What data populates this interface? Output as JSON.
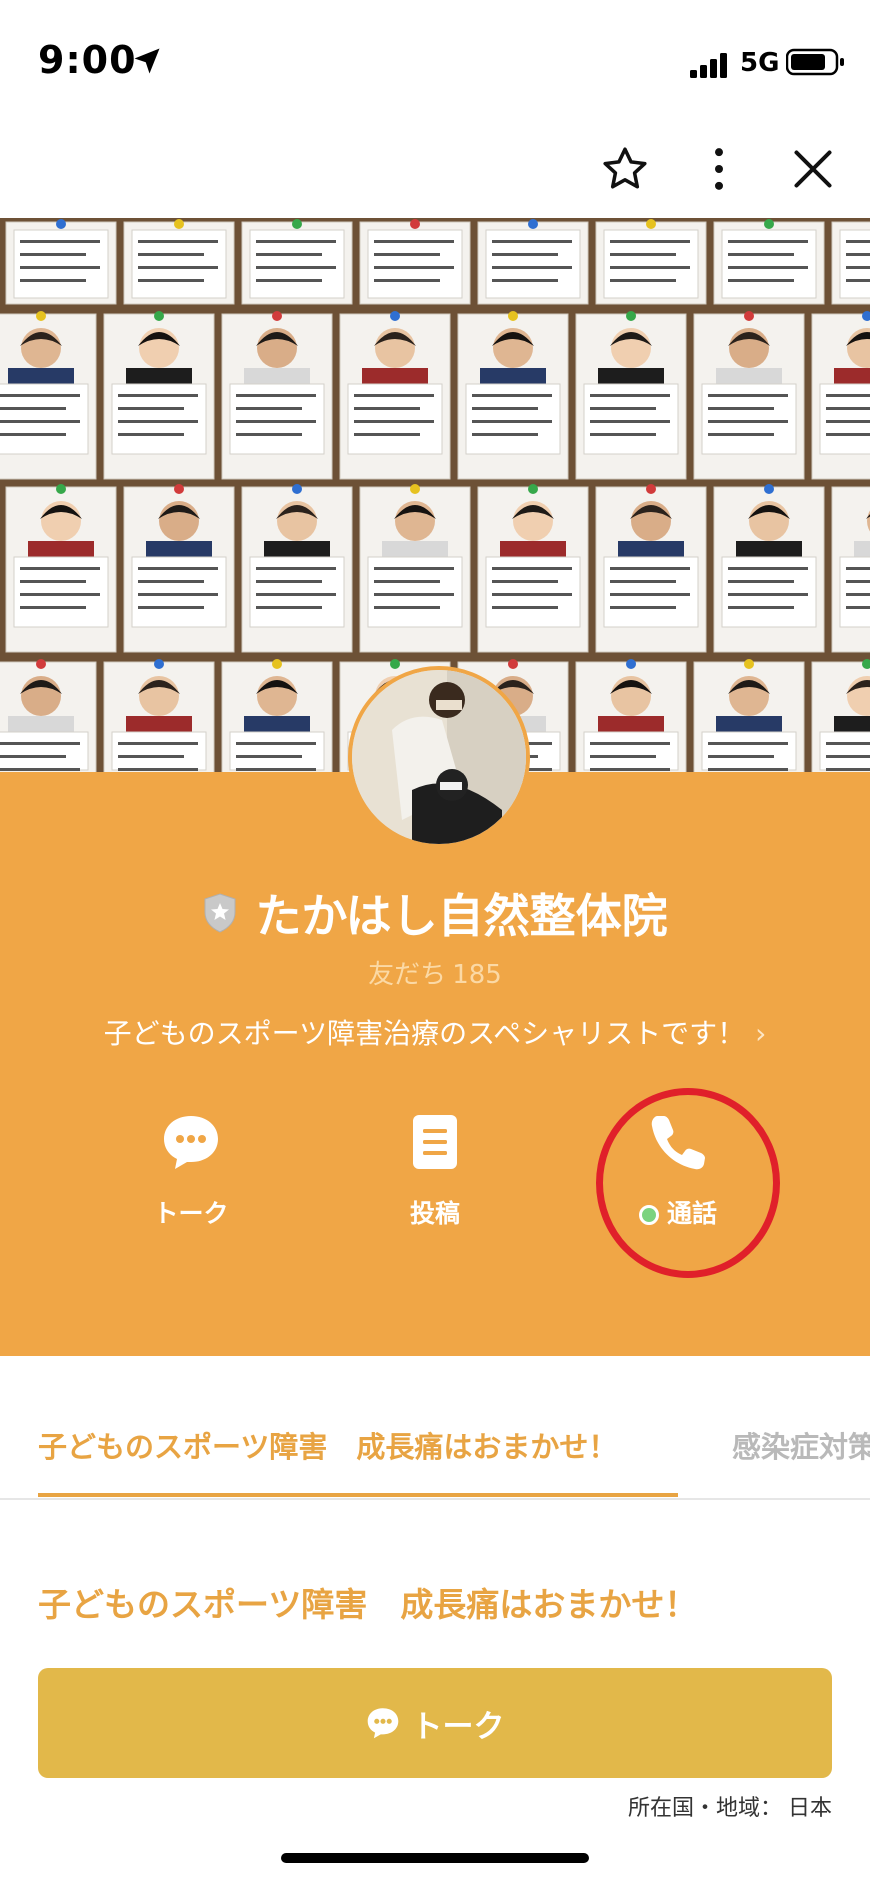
{
  "status_bar": {
    "time": "9:00",
    "network": "5G"
  },
  "header_actions": {
    "favorite_icon": "star-icon",
    "more_icon": "more-vertical-icon",
    "close_icon": "close-icon"
  },
  "profile": {
    "name": "たかはし自然整体院",
    "friends_label": "友だち",
    "friends_count": "185",
    "tagline": "子どものスポーツ障害治療のスペシャリストです！",
    "tagline_chevron": "›"
  },
  "actions": {
    "talk_label": "トーク",
    "post_label": "投稿",
    "call_label": "通話"
  },
  "tabs": [
    {
      "label": "子どものスポーツ障害　成長痛はおまかせ！",
      "active": true
    },
    {
      "label": "感染症対策",
      "active": false
    }
  ],
  "section": {
    "title": "子どものスポーツ障害　成長痛はおまかせ！"
  },
  "talk_button": {
    "label": "トーク"
  },
  "footer": {
    "region_label": "所在国・地域：",
    "region_value": "日本"
  },
  "colors": {
    "panel": "#f0a646",
    "accent": "#e8a443",
    "talk_button": "#e2b84a",
    "highlight_circle": "#e0202a",
    "online": "#7bd37f"
  }
}
